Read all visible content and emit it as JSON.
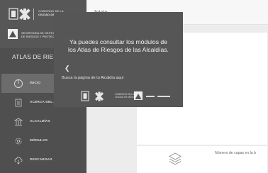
{
  "brand": {
    "gov_line1": "GOBIERNO DE LA",
    "gov_line2": "CIUDAD DE MÉXICO",
    "sec_line1": "SECRETARÍA DE GESTIÓN INTEGRAL",
    "sec_line2": "DE RIESGOS Y PROTECCIÓN CIVIL"
  },
  "app_title": "ATLAS DE RIESGOS",
  "nav": [
    {
      "label": "INICIO",
      "icon": "power-icon",
      "active": true
    },
    {
      "label": "ACERCA DEL ATLAS",
      "icon": "document-icon"
    },
    {
      "label": "ALCALDÍAS",
      "icon": "building-icon"
    },
    {
      "label": "MÓDULOS",
      "icon": "gear-icon"
    },
    {
      "label": "DESCARGAS",
      "icon": "cloud-download-icon"
    }
  ],
  "header": {
    "title": "Inicio"
  },
  "banner": {
    "headline_line1": "Ya puedes consultar los módulos de",
    "headline_line2": "los Atlas de Riesgos de las Alcaldías.",
    "cta": "Busca la página de tu Alcaldía aquí",
    "prev_icon": "chevron-left-icon",
    "footer_gov_line1": "GOBIERNO DE LA",
    "footer_gov_line2": "CIUDAD DE MÉXICO"
  },
  "layers_card": {
    "label": "Número de capas en la b"
  },
  "colors": {
    "sidebar": "#4f4f4f",
    "active": "#6c6c6c",
    "banner": "#565656"
  }
}
